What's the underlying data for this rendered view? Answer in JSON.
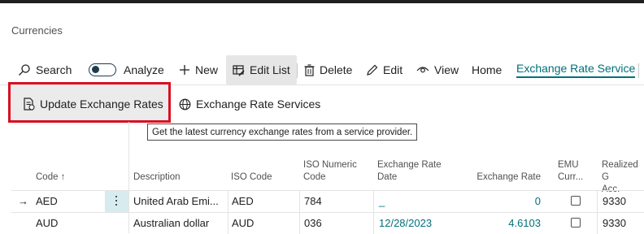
{
  "page": {
    "title": "Currencies"
  },
  "actions": {
    "search": "Search",
    "analyze": "Analyze",
    "new": "New",
    "edit_list": "Edit List",
    "delete": "Delete",
    "edit": "Edit",
    "view": "View",
    "home": "Home",
    "exchange_rate_service": "Exchange Rate Service"
  },
  "subactions": {
    "update_rates": "Update Exchange Rates",
    "services": "Exchange Rate Services"
  },
  "tooltip": "Get the latest currency exchange rates from a service provider.",
  "table": {
    "headers": {
      "code": "Code ↑",
      "description": "Description",
      "iso_code": "ISO Code",
      "iso_numeric_1": "ISO Numeric",
      "iso_numeric_2": "Code",
      "rate_date_1": "Exchange Rate",
      "rate_date_2": "Date",
      "exchange_rate": "Exchange Rate",
      "emu_1": "EMU",
      "emu_2": "Curr...",
      "realized_1": "Realized G",
      "realized_2": "Acc."
    },
    "rows": [
      {
        "arrow": "→",
        "code": "AED",
        "description": "United Arab Emi...",
        "iso_code": "AED",
        "iso_numeric": "784",
        "rate_date": "_",
        "exchange_rate": "0",
        "emu": false,
        "realized": "9330"
      },
      {
        "arrow": "",
        "code": "AUD",
        "description": "Australian dollar",
        "iso_code": "AUD",
        "iso_numeric": "036",
        "rate_date": "12/28/2023",
        "exchange_rate": "4.6103",
        "emu": false,
        "realized": "9330"
      }
    ]
  },
  "colors": {
    "accent": "#00707a",
    "highlight": "#d91020"
  }
}
